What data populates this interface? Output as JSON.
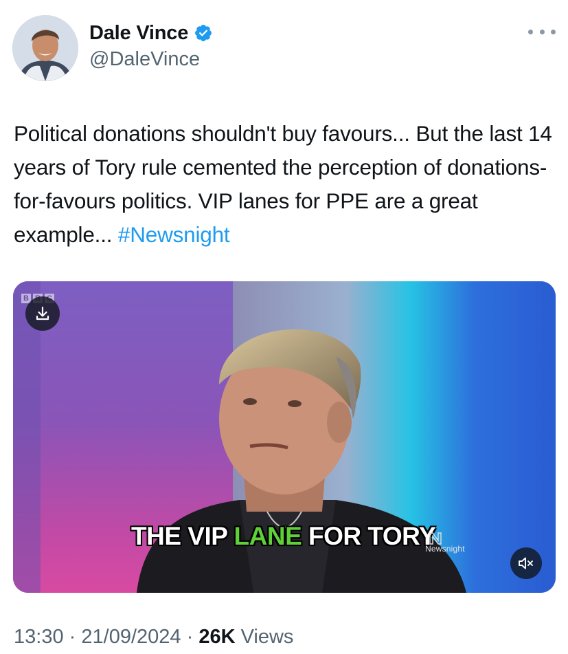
{
  "author": {
    "display_name": "Dale Vince",
    "handle": "@DaleVince",
    "verified": true,
    "avatar_icon": "avatar-photo",
    "more_icon": "more-options-icon"
  },
  "tweet": {
    "text": "Political donations shouldn't buy favours... But the last 14 years of Tory rule cemented the perception of donations-for-favours politics. VIP lanes for PPE are a great example...",
    "hashtag": "#Newsnight"
  },
  "media": {
    "type": "video",
    "bbc_letters": [
      "B",
      "B",
      "C"
    ],
    "caption_before": "THE VIP ",
    "caption_highlight": "LANE",
    "caption_after": " FOR TORY",
    "watermark": "Newsnight",
    "download_icon": "download-icon",
    "mute_icon": "muted-speaker-icon"
  },
  "footer": {
    "time": "13:30",
    "separator": "·",
    "date": "21/09/2024",
    "views_count": "26K",
    "views_label": "Views"
  },
  "colors": {
    "hashtag": "#1d9bf0",
    "verified": "#1d9bf0",
    "caption_highlight": "#5fd03a",
    "text_primary": "#0f1419",
    "text_secondary": "#536471"
  }
}
